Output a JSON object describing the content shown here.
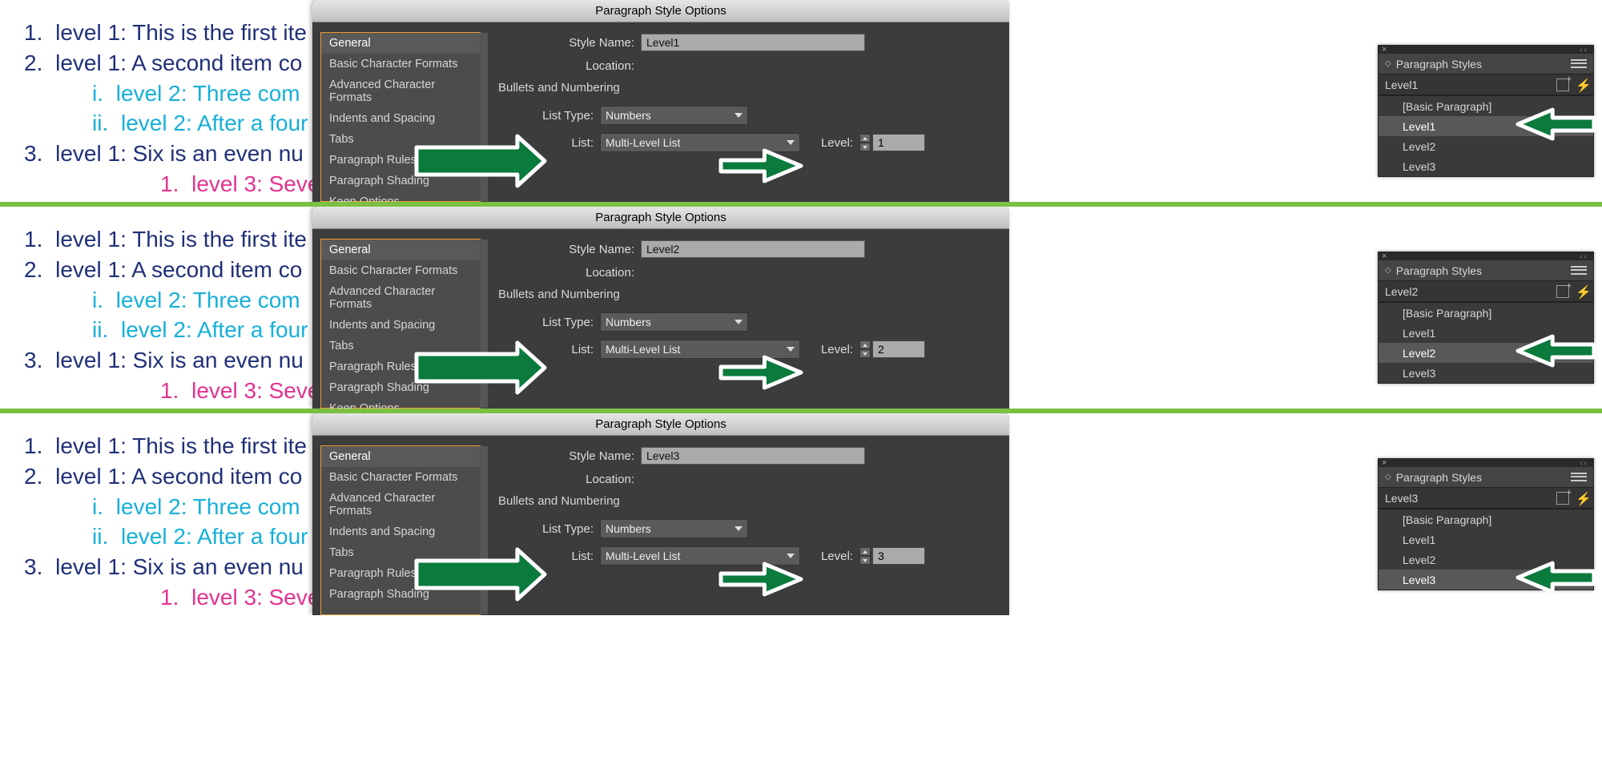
{
  "dialog_title": "Paragraph Style Options",
  "side_list": [
    "General",
    "Basic Character Formats",
    "Advanced Character Formats",
    "Indents and Spacing",
    "Tabs",
    "Paragraph Rules",
    "Paragraph Shading",
    "Keep Options"
  ],
  "labels": {
    "style_name": "Style Name:",
    "location": "Location:",
    "section": "Bullets and Numbering",
    "list_type": "List Type:",
    "list": "List:",
    "level": "Level:"
  },
  "list_type_value": "Numbers",
  "list_value": "Multi-Level List",
  "panel_title": "Paragraph Styles",
  "panel_items": [
    "[Basic Paragraph]",
    "Level1",
    "Level2",
    "Level3"
  ],
  "doc_lines": [
    {
      "cls": "",
      "num": "1.",
      "txt": "level 1: This is the first ite"
    },
    {
      "cls": "",
      "num": "2.",
      "txt": "level 1: A second item co"
    },
    {
      "cls": "l2",
      "num": "i.",
      "txt": "level 2: Three com"
    },
    {
      "cls": "l2",
      "num": "ii.",
      "txt": "level 2: After a four"
    },
    {
      "cls": "",
      "num": "3.",
      "txt": "level 1: Six is an even nu"
    },
    {
      "cls": "l3",
      "num": "1.",
      "txt": "level 3: Seve"
    }
  ],
  "rows": [
    {
      "style_name": "Level1",
      "level_value": "1",
      "panel_current": "Level1",
      "panel_selected": "Level1"
    },
    {
      "style_name": "Level2",
      "level_value": "2",
      "panel_current": "Level2",
      "panel_selected": "Level2"
    },
    {
      "style_name": "Level3",
      "level_value": "3",
      "panel_current": "Level3",
      "panel_selected": "Level3"
    }
  ]
}
